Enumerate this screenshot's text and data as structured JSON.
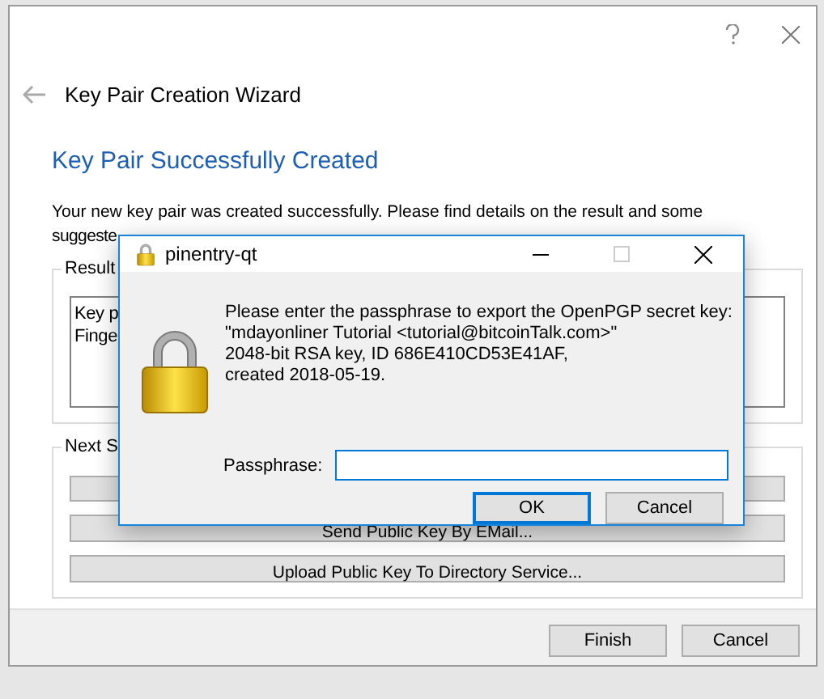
{
  "wizard": {
    "title": "Key Pair Creation Wizard",
    "heading": "Key Pair Successfully Created",
    "intro": [
      "Your new key pair was created successfully. Please find details on the result and some",
      "suggeste"
    ],
    "result_group": {
      "label": "Result",
      "lines": [
        "Key p",
        "Finge"
      ]
    },
    "next_group": {
      "label": "Next S",
      "buttons": [
        "Send Public Key By EMail...",
        "Upload Public Key To Directory Service..."
      ]
    },
    "footer_buttons": [
      "Finish",
      "Cancel"
    ]
  },
  "dialog": {
    "title": "pinentry-qt",
    "message": [
      "Please enter the passphrase to export the OpenPGP secret key:",
      "\"mdayonliner Tutorial <tutorial@bitcoinTalk.com>\"",
      "2048-bit RSA key, ID 686E410CD53E41AF,",
      "created 2018-05-19."
    ],
    "passphrase": {
      "label": "Passphrase:"
    },
    "buttons": [
      {
        "label": "OK",
        "focused": true
      },
      {
        "label": "Cancel",
        "focused": false
      }
    ]
  }
}
